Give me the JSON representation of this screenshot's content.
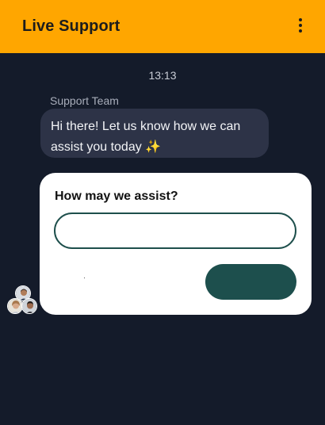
{
  "header": {
    "title": "Live Support",
    "menu_icon": "kebab-menu-icon",
    "background": "#ffa600"
  },
  "chat": {
    "timestamp": "13:13",
    "sender": "Support Team",
    "message": "Hi there! Let us know how we can assist you today ✨",
    "bubble_color": "#2d3347"
  },
  "form": {
    "question": "How may we assist?",
    "input_value": "",
    "input_placeholder": "",
    "submit_label": "",
    "accent": "#1d4f4d"
  },
  "agents": {
    "icon": "agent-avatars-icon"
  },
  "theme": {
    "background": "#141b2a"
  }
}
